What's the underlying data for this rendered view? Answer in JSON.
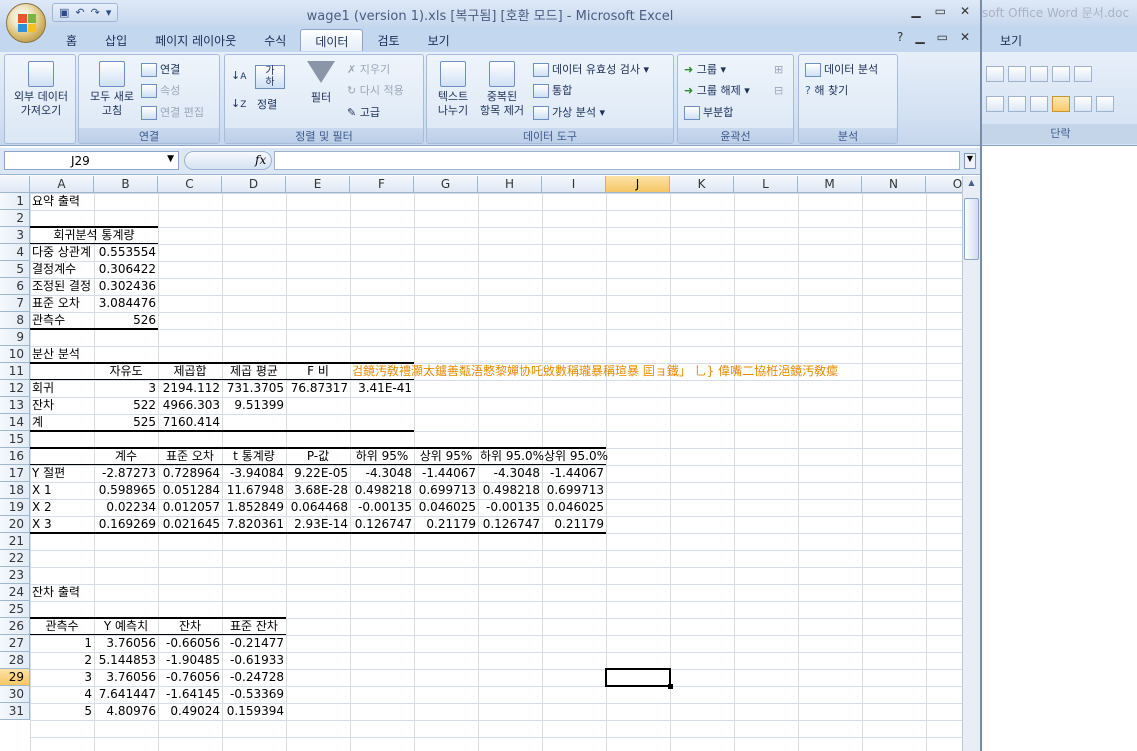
{
  "window": {
    "title": "wage1 (version 1).xls [복구됨] [호환 모드] - Microsoft Excel",
    "qat_undo": "↶",
    "qat_redo": "↷"
  },
  "tabs": [
    "홈",
    "삽입",
    "페이지 레이아웃",
    "수식",
    "데이터",
    "검토",
    "보기"
  ],
  "active_tab": "데이터",
  "ribbon": {
    "external_data": "외부 데이터\n가져오기",
    "refresh_all": "모두 새로\n고침",
    "connections": "연결",
    "properties": "속성",
    "edit_links": "연결 편집",
    "group_connections": "연결",
    "sort": "정렬",
    "filter": "필터",
    "clear": "지우기",
    "reapply": "다시 적용",
    "advanced": "고급",
    "group_sort_filter": "정렬 및 필터",
    "text_to_columns": "텍스트\n나누기",
    "remove_duplicates": "중복된\n항목 제거",
    "data_validation": "데이터 유효성 검사",
    "consolidate": "통합",
    "what_if": "가상 분석",
    "group_data_tools": "데이터 도구",
    "group_btn": "그룹",
    "ungroup_btn": "그룹 해제",
    "subtotal": "부분합",
    "group_outline": "윤곽선",
    "data_analysis": "데이터 분석",
    "solver": "해 찾기",
    "group_analysis": "분석",
    "sort_az_icon": "가\n하"
  },
  "formula_bar": {
    "name_box": "J29",
    "fx": "fx",
    "value": ""
  },
  "columns": [
    "A",
    "B",
    "C",
    "D",
    "E",
    "F",
    "G",
    "H",
    "I",
    "J",
    "K",
    "L",
    "M",
    "N",
    "O"
  ],
  "rows": [
    "1",
    "2",
    "3",
    "4",
    "5",
    "6",
    "7",
    "8",
    "9",
    "10",
    "11",
    "12",
    "13",
    "14",
    "15",
    "16",
    "17",
    "18",
    "19",
    "20",
    "21",
    "22",
    "23",
    "24",
    "25",
    "26",
    "27",
    "28",
    "29",
    "30",
    "31"
  ],
  "selected_cell": "J29",
  "sheet": {
    "summary_title": "요약 출력",
    "reg_stats_header": "회귀분석 통계량",
    "reg_stats": [
      {
        "label": "다중 상관계",
        "value": "0.553554"
      },
      {
        "label": "결정계수",
        "value": "0.306422"
      },
      {
        "label": "조정된 결정",
        "value": "0.302436"
      },
      {
        "label": "표준 오차",
        "value": "3.084476"
      },
      {
        "label": "관측수",
        "value": "526"
      }
    ],
    "anova_title": "분산 분석",
    "anova_headers": [
      "자유도",
      "제곱합",
      "제곱 평균",
      "F 비"
    ],
    "anova_garbled": "검鏡汚敎禮灝太鑪善甐浯慗黎嬋协吒敓數稱瓏暴稱瑄暴  囸ョ鐡」  乚}   偉嘴二協栣浥鏡汚敎癛",
    "anova_rows": [
      {
        "label": "회귀",
        "df": "3",
        "ss": "2194.112",
        "ms": "731.3705",
        "f": "76.87317",
        "sig": "3.41E-41"
      },
      {
        "label": "잔차",
        "df": "522",
        "ss": "4966.303",
        "ms": "9.51399",
        "f": "",
        "sig": ""
      },
      {
        "label": "계",
        "df": "525",
        "ss": "7160.414",
        "ms": "",
        "f": "",
        "sig": ""
      }
    ],
    "coef_headers": [
      "계수",
      "표준 오차",
      "t 통계량",
      "P-값",
      "하위 95%",
      "상위 95%",
      "하위 95.0%",
      "상위 95.0%"
    ],
    "coef_rows": [
      {
        "label": "Y 절편",
        "values": [
          "-2.87273",
          "0.728964",
          "-3.94084",
          "9.22E-05",
          "-4.3048",
          "-1.44067",
          "-4.3048",
          "-1.44067"
        ]
      },
      {
        "label": "X 1",
        "values": [
          "0.598965",
          "0.051284",
          "11.67948",
          "3.68E-28",
          "0.498218",
          "0.699713",
          "0.498218",
          "0.699713"
        ]
      },
      {
        "label": "X 2",
        "values": [
          "0.02234",
          "0.012057",
          "1.852849",
          "0.064468",
          "-0.00135",
          "0.046025",
          "-0.00135",
          "0.046025"
        ]
      },
      {
        "label": "X 3",
        "values": [
          "0.169269",
          "0.021645",
          "7.820361",
          "2.93E-14",
          "0.126747",
          "0.21179",
          "0.126747",
          "0.21179"
        ]
      }
    ],
    "residual_title": "잔차 출력",
    "residual_headers": [
      "관측수",
      "Y 예측치",
      "잔차",
      "표준 잔차"
    ],
    "residual_rows": [
      [
        "1",
        "3.76056",
        "-0.66056",
        "-0.21477"
      ],
      [
        "2",
        "5.144853",
        "-1.90485",
        "-0.61933"
      ],
      [
        "3",
        "3.76056",
        "-0.76056",
        "-0.24728"
      ],
      [
        "4",
        "7.641447",
        "-1.64145",
        "-0.53369"
      ],
      [
        "5",
        "4.80976",
        "0.49024",
        "0.159394"
      ]
    ]
  },
  "word": {
    "title": "soft Office Word 문서.doc",
    "tab": "보기",
    "group_label": "단락"
  }
}
